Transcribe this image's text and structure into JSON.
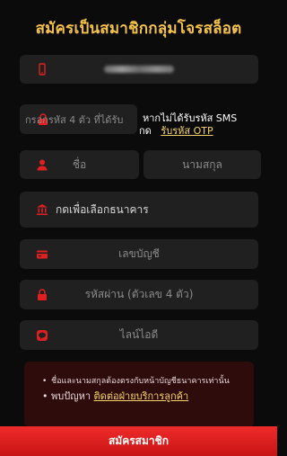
{
  "header": {
    "title": "สมัครเป็นสมาชิกกลุ่มโจรสล็อต"
  },
  "form": {
    "phone_placeholder": "",
    "otp_placeholder": "กรอกรหัส 4 ตัว ที่ได้รับ",
    "otp_help_text": "หากไม่ได้รับรหัส SMS",
    "otp_help_press": "กด",
    "otp_link": "รับรหัส OTP",
    "first_name_placeholder": "ชื่อ",
    "last_name_placeholder": "นามสกุล",
    "bank_label": "กดเพื่อเลือกธนาคาร",
    "account_placeholder": "เลขบัญชี",
    "password_placeholder": "รหัสผ่าน (ตัวเลข 4 ตัว)",
    "line_placeholder": "ไลน์ไอดี"
  },
  "notice": {
    "items": [
      "ชื่อและนามสกุลต้องตรงกับหน้าบัญชีธนาคารเท่านั้น"
    ],
    "contact_prefix": "พบปัญหา",
    "contact_link": "ติดต่อฝ่ายบริการลูกค้า"
  },
  "footer": {
    "submit_label": "สมัครสมาชิก"
  },
  "colors": {
    "accent": "#f4c24a",
    "brand_red": "#e02020",
    "field_bg": "#202020",
    "notice_bg": "#2e0c0c"
  },
  "icons": [
    "phone-icon",
    "lock-icon",
    "user-icon",
    "bank-icon",
    "card-icon",
    "lock-icon",
    "line-icon"
  ]
}
